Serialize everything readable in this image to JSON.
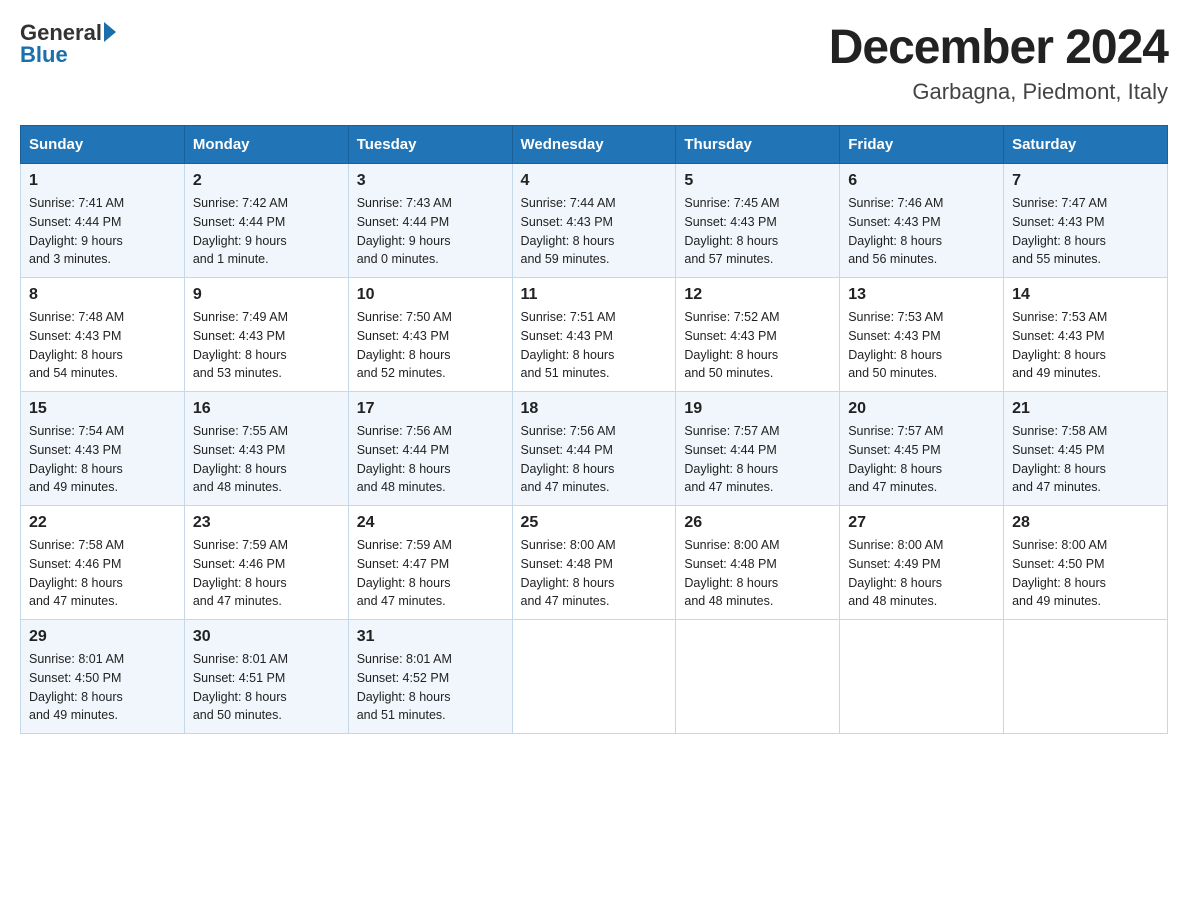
{
  "logo": {
    "text_general": "General",
    "text_blue": "Blue"
  },
  "title": "December 2024",
  "location": "Garbagna, Piedmont, Italy",
  "days": [
    "Sunday",
    "Monday",
    "Tuesday",
    "Wednesday",
    "Thursday",
    "Friday",
    "Saturday"
  ],
  "weeks": [
    [
      {
        "day": "1",
        "sunrise": "7:41 AM",
        "sunset": "4:44 PM",
        "daylight": "9 hours and 3 minutes."
      },
      {
        "day": "2",
        "sunrise": "7:42 AM",
        "sunset": "4:44 PM",
        "daylight": "9 hours and 1 minute."
      },
      {
        "day": "3",
        "sunrise": "7:43 AM",
        "sunset": "4:44 PM",
        "daylight": "9 hours and 0 minutes."
      },
      {
        "day": "4",
        "sunrise": "7:44 AM",
        "sunset": "4:43 PM",
        "daylight": "8 hours and 59 minutes."
      },
      {
        "day": "5",
        "sunrise": "7:45 AM",
        "sunset": "4:43 PM",
        "daylight": "8 hours and 57 minutes."
      },
      {
        "day": "6",
        "sunrise": "7:46 AM",
        "sunset": "4:43 PM",
        "daylight": "8 hours and 56 minutes."
      },
      {
        "day": "7",
        "sunrise": "7:47 AM",
        "sunset": "4:43 PM",
        "daylight": "8 hours and 55 minutes."
      }
    ],
    [
      {
        "day": "8",
        "sunrise": "7:48 AM",
        "sunset": "4:43 PM",
        "daylight": "8 hours and 54 minutes."
      },
      {
        "day": "9",
        "sunrise": "7:49 AM",
        "sunset": "4:43 PM",
        "daylight": "8 hours and 53 minutes."
      },
      {
        "day": "10",
        "sunrise": "7:50 AM",
        "sunset": "4:43 PM",
        "daylight": "8 hours and 52 minutes."
      },
      {
        "day": "11",
        "sunrise": "7:51 AM",
        "sunset": "4:43 PM",
        "daylight": "8 hours and 51 minutes."
      },
      {
        "day": "12",
        "sunrise": "7:52 AM",
        "sunset": "4:43 PM",
        "daylight": "8 hours and 50 minutes."
      },
      {
        "day": "13",
        "sunrise": "7:53 AM",
        "sunset": "4:43 PM",
        "daylight": "8 hours and 50 minutes."
      },
      {
        "day": "14",
        "sunrise": "7:53 AM",
        "sunset": "4:43 PM",
        "daylight": "8 hours and 49 minutes."
      }
    ],
    [
      {
        "day": "15",
        "sunrise": "7:54 AM",
        "sunset": "4:43 PM",
        "daylight": "8 hours and 49 minutes."
      },
      {
        "day": "16",
        "sunrise": "7:55 AM",
        "sunset": "4:43 PM",
        "daylight": "8 hours and 48 minutes."
      },
      {
        "day": "17",
        "sunrise": "7:56 AM",
        "sunset": "4:44 PM",
        "daylight": "8 hours and 48 minutes."
      },
      {
        "day": "18",
        "sunrise": "7:56 AM",
        "sunset": "4:44 PM",
        "daylight": "8 hours and 47 minutes."
      },
      {
        "day": "19",
        "sunrise": "7:57 AM",
        "sunset": "4:44 PM",
        "daylight": "8 hours and 47 minutes."
      },
      {
        "day": "20",
        "sunrise": "7:57 AM",
        "sunset": "4:45 PM",
        "daylight": "8 hours and 47 minutes."
      },
      {
        "day": "21",
        "sunrise": "7:58 AM",
        "sunset": "4:45 PM",
        "daylight": "8 hours and 47 minutes."
      }
    ],
    [
      {
        "day": "22",
        "sunrise": "7:58 AM",
        "sunset": "4:46 PM",
        "daylight": "8 hours and 47 minutes."
      },
      {
        "day": "23",
        "sunrise": "7:59 AM",
        "sunset": "4:46 PM",
        "daylight": "8 hours and 47 minutes."
      },
      {
        "day": "24",
        "sunrise": "7:59 AM",
        "sunset": "4:47 PM",
        "daylight": "8 hours and 47 minutes."
      },
      {
        "day": "25",
        "sunrise": "8:00 AM",
        "sunset": "4:48 PM",
        "daylight": "8 hours and 47 minutes."
      },
      {
        "day": "26",
        "sunrise": "8:00 AM",
        "sunset": "4:48 PM",
        "daylight": "8 hours and 48 minutes."
      },
      {
        "day": "27",
        "sunrise": "8:00 AM",
        "sunset": "4:49 PM",
        "daylight": "8 hours and 48 minutes."
      },
      {
        "day": "28",
        "sunrise": "8:00 AM",
        "sunset": "4:50 PM",
        "daylight": "8 hours and 49 minutes."
      }
    ],
    [
      {
        "day": "29",
        "sunrise": "8:01 AM",
        "sunset": "4:50 PM",
        "daylight": "8 hours and 49 minutes."
      },
      {
        "day": "30",
        "sunrise": "8:01 AM",
        "sunset": "4:51 PM",
        "daylight": "8 hours and 50 minutes."
      },
      {
        "day": "31",
        "sunrise": "8:01 AM",
        "sunset": "4:52 PM",
        "daylight": "8 hours and 51 minutes."
      },
      null,
      null,
      null,
      null
    ]
  ]
}
